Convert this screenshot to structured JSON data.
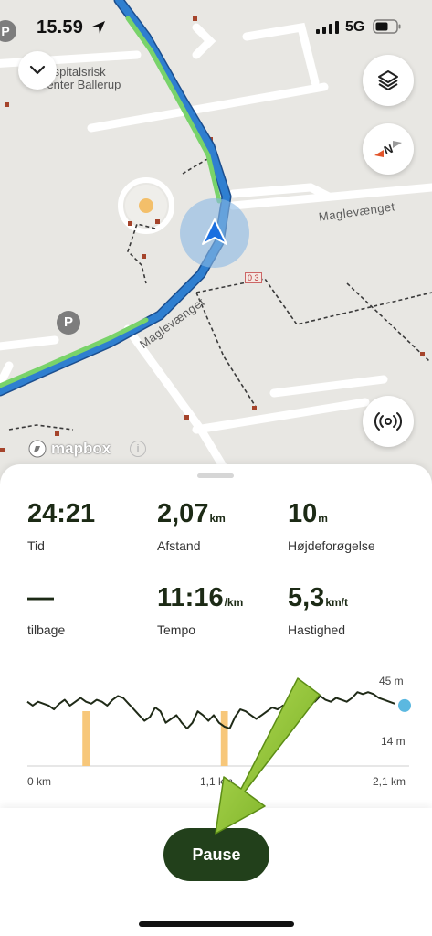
{
  "status_bar": {
    "time": "15.59",
    "network": "5G"
  },
  "map": {
    "road_labels": [
      "Maglevænget",
      "Maglevænget"
    ],
    "place_label_line1": "Hospitalsrisk",
    "place_label_line2": "Center Ballerup",
    "marker_text": "0 3",
    "parking": "P",
    "attribution": "mapbox",
    "info": "i"
  },
  "stats": {
    "time": {
      "value": "24:21",
      "unit": "",
      "label": "Tid"
    },
    "distance": {
      "value": "2,07",
      "unit": "km",
      "label": "Afstand"
    },
    "elevation_gain": {
      "value": "10",
      "unit": "m",
      "label": "Højdeforøgelse"
    },
    "remaining": {
      "value": "—",
      "unit": "",
      "label": "tilbage"
    },
    "pace": {
      "value": "11:16",
      "unit": "/km",
      "label": "Tempo"
    },
    "speed": {
      "value": "5,3",
      "unit": "km/t",
      "label": "Hastighed"
    }
  },
  "chart_data": {
    "type": "line",
    "title": "",
    "xlabel": "",
    "ylabel": "",
    "x_ticks": [
      "0 km",
      "1,1 km",
      "2,1 km"
    ],
    "y_ticks": [
      "45 m",
      "14 m"
    ],
    "xlim": [
      0,
      2.1
    ],
    "ylim": [
      14,
      45
    ],
    "series": [
      {
        "x": [
          0.0,
          0.03,
          0.06,
          0.09,
          0.12,
          0.15,
          0.18,
          0.21,
          0.24,
          0.27,
          0.3,
          0.33,
          0.36,
          0.39,
          0.42,
          0.45,
          0.48,
          0.51,
          0.54,
          0.57,
          0.6,
          0.63,
          0.66,
          0.69,
          0.72,
          0.75,
          0.78,
          0.81,
          0.84,
          0.87,
          0.9,
          0.93,
          0.96,
          0.99,
          1.02,
          1.05,
          1.08,
          1.11,
          1.14,
          1.17,
          1.2,
          1.23,
          1.26,
          1.29,
          1.32,
          1.35,
          1.38,
          1.41,
          1.44,
          1.47,
          1.5,
          1.53,
          1.56,
          1.59,
          1.62,
          1.65,
          1.68,
          1.71,
          1.74,
          1.77,
          1.8,
          1.83,
          1.86,
          1.89,
          1.92,
          1.95,
          1.98,
          2.01,
          2.04,
          2.07
        ],
        "y": [
          38,
          36,
          38,
          37,
          36,
          34,
          37,
          39,
          36,
          38,
          40,
          38,
          37,
          39,
          38,
          36,
          39,
          41,
          40,
          37,
          34,
          31,
          28,
          30,
          35,
          33,
          27,
          29,
          31,
          27,
          24,
          27,
          33,
          31,
          28,
          31,
          27,
          25,
          24,
          30,
          34,
          33,
          31,
          29,
          31,
          33,
          35,
          34,
          36,
          35,
          37,
          39,
          42,
          40,
          38,
          41,
          39,
          38,
          40,
          39,
          38,
          40,
          43,
          42,
          43,
          42,
          40,
          39,
          38,
          37
        ]
      }
    ],
    "highlights_km": [
      [
        0.31,
        0.35
      ],
      [
        1.09,
        1.13
      ]
    ],
    "current_point": {
      "x": 2.1,
      "y": 36
    },
    "colors": {
      "line": "#1f2a17",
      "highlight": "#f7c77a",
      "current": "#5bb8e0"
    }
  },
  "actions": {
    "pause_label": "Pause"
  },
  "colors": {
    "primary": "#22401b",
    "route_blue": "#2f7fd0",
    "route_green": "#79d36a",
    "arrow_green": "#8bc524"
  }
}
